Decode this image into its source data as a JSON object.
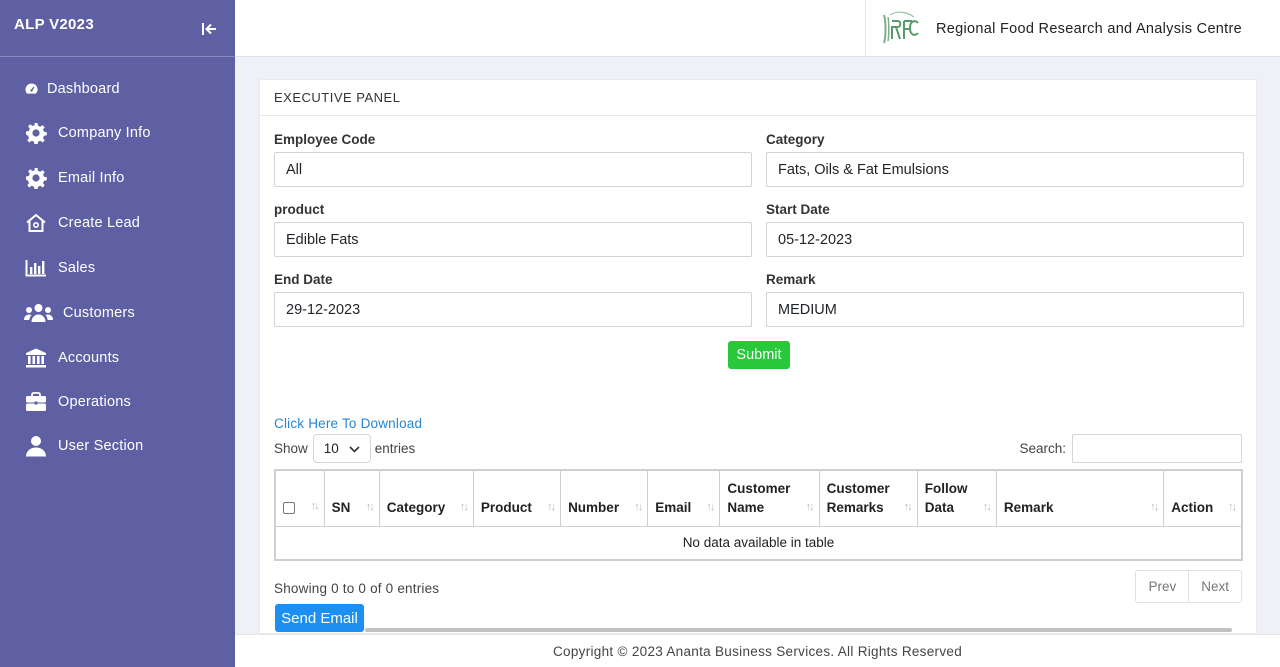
{
  "sidebar": {
    "title": "ALP V2023",
    "items": [
      {
        "label": "Dashboard",
        "icon": "dashboard-icon"
      },
      {
        "label": "Company Info",
        "icon": "gear-icon"
      },
      {
        "label": "Email Info",
        "icon": "gear-icon"
      },
      {
        "label": "Create Lead",
        "icon": "home-icon"
      },
      {
        "label": "Sales",
        "icon": "bar-chart-icon"
      },
      {
        "label": "Customers",
        "icon": "users-icon"
      },
      {
        "label": "Accounts",
        "icon": "bank-icon"
      },
      {
        "label": "Operations",
        "icon": "briefcase-icon"
      },
      {
        "label": "User Section",
        "icon": "user-icon"
      }
    ]
  },
  "header": {
    "org_name": "Regional Food Research and Analysis Centre"
  },
  "panel": {
    "title": "EXECUTIVE PANEL",
    "fields": {
      "employee_code": {
        "label": "Employee Code",
        "value": "All"
      },
      "category": {
        "label": "Category",
        "value": "Fats, Oils & Fat Emulsions"
      },
      "product": {
        "label": "product",
        "value": "Edible Fats"
      },
      "start_date": {
        "label": "Start Date",
        "value": "05-12-2023"
      },
      "end_date": {
        "label": "End Date",
        "value": "29-12-2023"
      },
      "remark": {
        "label": "Remark",
        "value": "MEDIUM"
      }
    },
    "submit_label": "Submit",
    "download_link": "Click Here To Download"
  },
  "table": {
    "show_label": "Show",
    "page_length": "10",
    "entries_label": "entries",
    "search_label": "Search:",
    "columns": [
      {
        "line1": "SN",
        "line2": ""
      },
      {
        "line1": "Category",
        "line2": ""
      },
      {
        "line1": "Product",
        "line2": ""
      },
      {
        "line1": "Number",
        "line2": ""
      },
      {
        "line1": "Email",
        "line2": ""
      },
      {
        "line1": "Customer",
        "line2": "Name"
      },
      {
        "line1": "Customer",
        "line2": "Remarks"
      },
      {
        "line1": "Follow",
        "line2": "Data"
      },
      {
        "line1": "Remark",
        "line2": ""
      },
      {
        "line1": "Action",
        "line2": ""
      }
    ],
    "empty_message": "No data available in table",
    "info": "Showing 0 to 0 of 0 entries",
    "prev_label": "Prev",
    "next_label": "Next",
    "send_email_label": "Send Email"
  },
  "footer": {
    "copyright": "Copyright © 2023 Ananta Business Services. All Rights Reserved"
  },
  "colors": {
    "sidebar_bg": "#5f60a3",
    "submit_bg": "#28c83a",
    "send_email_bg": "#1d8ff2",
    "link": "#2486d4"
  }
}
